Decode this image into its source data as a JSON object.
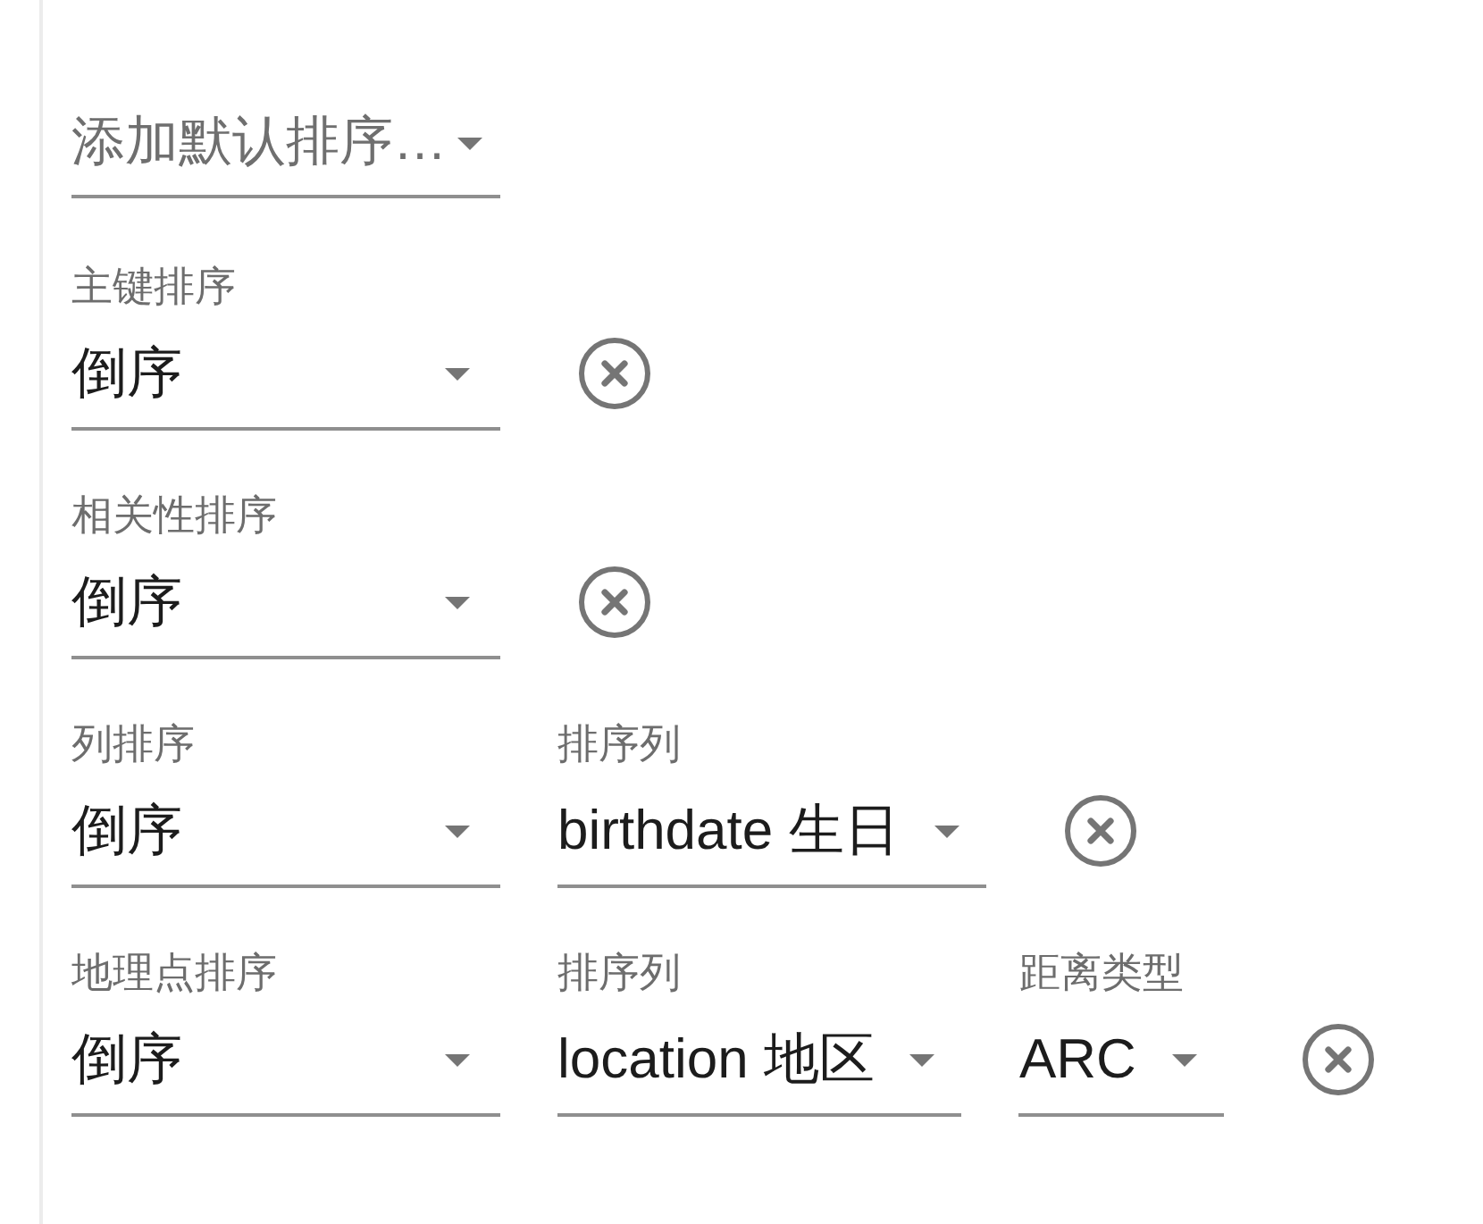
{
  "add_sort": {
    "placeholder": "添加默认排序…"
  },
  "sort_rules": [
    {
      "fields": [
        {
          "label": "主键排序",
          "value": "倒序"
        }
      ]
    },
    {
      "fields": [
        {
          "label": "相关性排序",
          "value": "倒序"
        }
      ]
    },
    {
      "fields": [
        {
          "label": "列排序",
          "value": "倒序"
        },
        {
          "label": "排序列",
          "value": "birthdate 生日"
        }
      ]
    },
    {
      "fields": [
        {
          "label": "地理点排序",
          "value": "倒序"
        },
        {
          "label": "排序列",
          "value": "location 地区"
        },
        {
          "label": "距离类型",
          "value": "ARC"
        }
      ]
    }
  ]
}
